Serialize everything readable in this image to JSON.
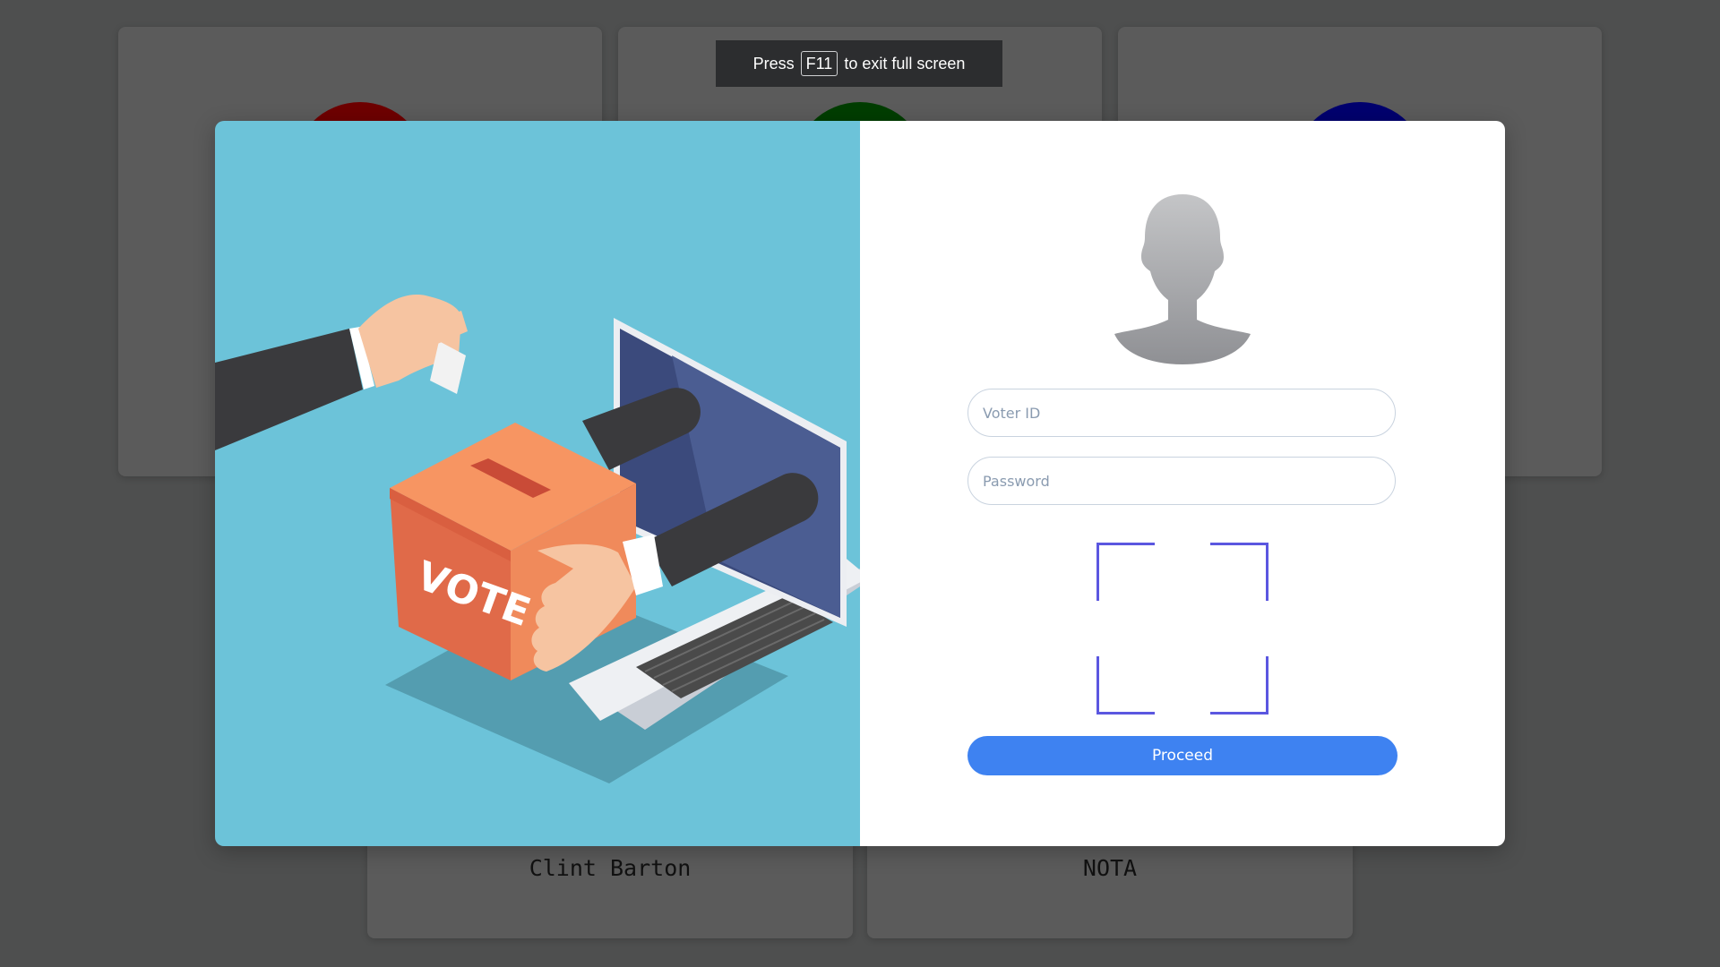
{
  "fullscreen_notice": {
    "prefix": "Press",
    "key": "F11",
    "suffix": "to exit full screen"
  },
  "background_cards": {
    "row1_colors": [
      "#6e0000",
      "#003d00",
      "#00006e"
    ],
    "row2_names": [
      "Clint Barton",
      "NOTA"
    ]
  },
  "login": {
    "illustration_label": "VOTE",
    "voter_id_placeholder": "Voter ID",
    "password_placeholder": "Password",
    "proceed_label": "Proceed"
  },
  "colors": {
    "overlay_background": "#4e4f4f",
    "illustration_background": "#6cc3d9",
    "scanner_frame": "#5b57e0",
    "proceed_button": "#3e82f1"
  },
  "icons": [
    "user-silhouette-icon",
    "face-scan-frame-icon"
  ]
}
